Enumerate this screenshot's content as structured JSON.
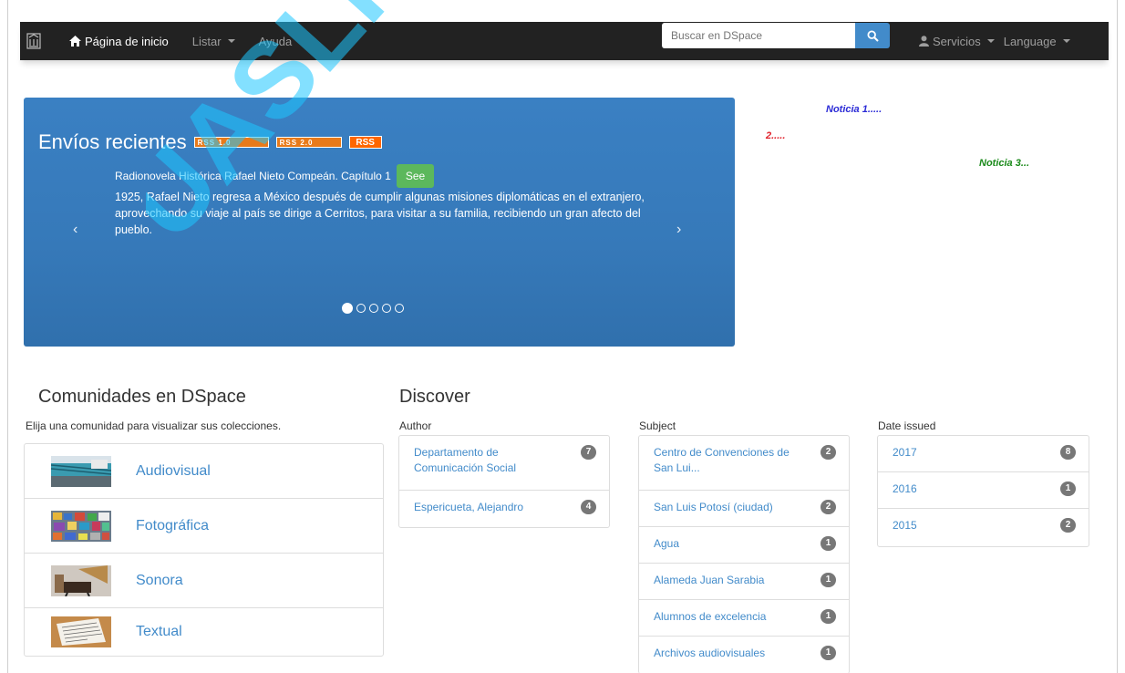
{
  "navbar": {
    "home": "Página de inicio",
    "listar": "Listar",
    "ayuda": "Ayuda",
    "search_placeholder": "Buscar en DSpace",
    "servicios": "Servicios",
    "language": "Language"
  },
  "carousel": {
    "title": "Envíos recientes",
    "feed_badges": [
      "RSS 1.0",
      "RSS 2.0",
      "RSS"
    ],
    "item_title": "Radionovela Histórica Rafael Nieto Compeán. Capítulo 1",
    "see_label": "See",
    "description": "1925, Rafael Nieto regresa a México después de cumplir algunas misiones diplomáticas en el extranjero, aprovechando su viaje al país se dirige a Cerritos, para visitar a su familia, recibiendo un gran afecto del pueblo.",
    "prev": "‹",
    "next": "›",
    "slide_count": 5,
    "active_slide": 1
  },
  "news": [
    {
      "text": "Noticia 1.....",
      "color": "#2b2bd6"
    },
    {
      "text": "2.....",
      "color": "#e0202a"
    },
    {
      "text": "Noticia 3...",
      "color": "#1a8a1a"
    }
  ],
  "communities": {
    "title": "Comunidades en DSpace",
    "subtitle": "Elija una comunidad para visualizar sus colecciones.",
    "items": [
      {
        "label": "Audiovisual"
      },
      {
        "label": "Fotográfica"
      },
      {
        "label": "Sonora"
      },
      {
        "label": "Textual"
      }
    ]
  },
  "discover": {
    "title": "Discover",
    "author": {
      "label": "Author",
      "items": [
        {
          "text": "Departamento de Comunicación Social",
          "count": "7"
        },
        {
          "text": "Espericueta, Alejandro",
          "count": "4"
        }
      ]
    },
    "subject": {
      "label": "Subject",
      "items": [
        {
          "text": "Centro de Convenciones de San Lui...",
          "count": "2"
        },
        {
          "text": "San Luis Potosí (ciudad)",
          "count": "2"
        },
        {
          "text": "Agua",
          "count": "1"
        },
        {
          "text": "Alameda Juan Sarabia",
          "count": "1"
        },
        {
          "text": "Alumnos de excelencia",
          "count": "1"
        },
        {
          "text": "Archivos audiovisuales",
          "count": "1"
        }
      ]
    },
    "date": {
      "label": "Date issued",
      "items": [
        {
          "text": "2017",
          "count": "8"
        },
        {
          "text": "2016",
          "count": "1"
        },
        {
          "text": "2015",
          "count": "2"
        }
      ]
    }
  },
  "watermark": "UASLP",
  "colors": {
    "navbar": "#222222",
    "link": "#428bca",
    "carousel": "#3679b9",
    "see_button": "#5cb85c",
    "badge": "#777777"
  }
}
